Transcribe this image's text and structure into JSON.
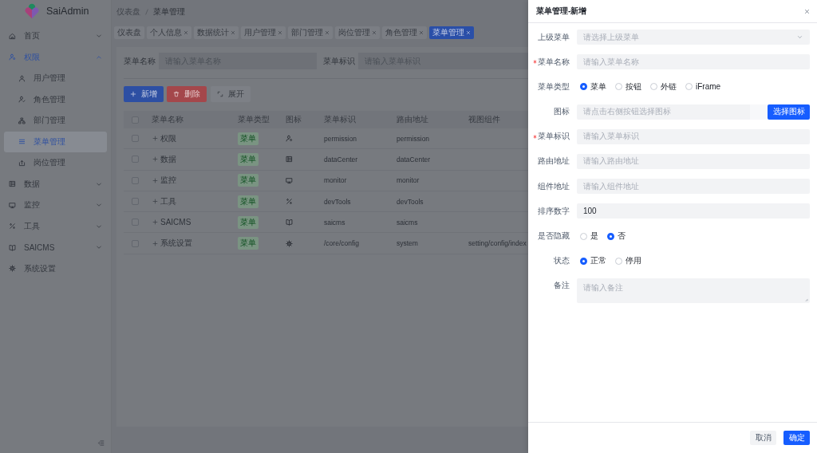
{
  "sidebar": {
    "logo": "SaiAdmin",
    "items": [
      {
        "label": "首页",
        "expanded": false,
        "selected": false
      },
      {
        "label": "权限",
        "expanded": true,
        "selected": false,
        "children": [
          {
            "label": "用户管理",
            "selected": false
          },
          {
            "label": "角色管理",
            "selected": false
          },
          {
            "label": "部门管理",
            "selected": false
          },
          {
            "label": "菜单管理",
            "selected": true
          },
          {
            "label": "岗位管理",
            "selected": false
          }
        ]
      },
      {
        "label": "数据",
        "expanded": false,
        "selected": false
      },
      {
        "label": "监控",
        "expanded": false,
        "selected": false
      },
      {
        "label": "工具",
        "expanded": false,
        "selected": false
      },
      {
        "label": "SAICMS",
        "expanded": false,
        "selected": false
      },
      {
        "label": "系统设置",
        "selected": false
      }
    ]
  },
  "breadcrumb": [
    "仪表盘",
    "菜单管理"
  ],
  "tabs": [
    {
      "label": "仪表盘",
      "closable": false,
      "selected": false
    },
    {
      "label": "个人信息",
      "closable": true,
      "selected": false
    },
    {
      "label": "数据统计",
      "closable": true,
      "selected": false
    },
    {
      "label": "用户管理",
      "closable": true,
      "selected": false
    },
    {
      "label": "部门管理",
      "closable": true,
      "selected": false
    },
    {
      "label": "岗位管理",
      "closable": true,
      "selected": false
    },
    {
      "label": "角色管理",
      "closable": true,
      "selected": false
    },
    {
      "label": "菜单管理",
      "closable": true,
      "selected": true
    }
  ],
  "search": {
    "fields": [
      {
        "label": "菜单名称",
        "placeholder": "请输入菜单名称"
      },
      {
        "label": "菜单标识",
        "placeholder": "请输入菜单标识"
      }
    ]
  },
  "actions": [
    {
      "label": "新增",
      "kind": "primary"
    },
    {
      "label": "删除",
      "kind": "danger"
    },
    {
      "label": "展开",
      "kind": "default"
    }
  ],
  "table": {
    "select_all": {
      "checked": false
    },
    "columns": [
      "菜单名称",
      "菜单类型",
      "图标",
      "菜单标识",
      "路由地址",
      "视图组件"
    ],
    "rows": [
      {
        "name": "权限",
        "type": "菜单",
        "key": "permission",
        "route": "permission",
        "checked": false,
        "expanded": false
      },
      {
        "name": "数据",
        "type": "菜单",
        "key": "dataCenter",
        "route": "dataCenter",
        "checked": false,
        "expanded": false
      },
      {
        "name": "监控",
        "type": "菜单",
        "key": "monitor",
        "route": "monitor",
        "checked": false,
        "expanded": false
      },
      {
        "name": "工具",
        "type": "菜单",
        "key": "devTools",
        "route": "devTools",
        "checked": false,
        "expanded": false
      },
      {
        "name": "SAICMS",
        "type": "菜单",
        "key": "saicms",
        "route": "saicms",
        "checked": false,
        "expanded": false
      },
      {
        "name": "系统设置",
        "type": "菜单",
        "key": "/core/config",
        "route": "system",
        "component": "setting/config/index",
        "checked": false,
        "expanded": false
      }
    ]
  },
  "drawer": {
    "title": "菜单管理-新增",
    "fields": [
      {
        "kind": "select",
        "label": "上级菜单",
        "required": false,
        "placeholder": "请选择上级菜单"
      },
      {
        "kind": "input",
        "label": "菜单名称",
        "required": true,
        "placeholder": "请输入菜单名称"
      },
      {
        "kind": "radio",
        "label": "菜单类型",
        "required": false,
        "options": [
          {
            "label": "菜单",
            "selected": true
          },
          {
            "label": "按钮",
            "selected": false
          },
          {
            "label": "外链",
            "selected": false
          },
          {
            "label": "iFrame",
            "selected": false
          }
        ]
      },
      {
        "kind": "icon_picker",
        "label": "图标",
        "required": false,
        "placeholder": "请点击右侧按钮选择图标",
        "button": "选择图标"
      },
      {
        "kind": "input",
        "label": "菜单标识",
        "required": true,
        "placeholder": "请输入菜单标识"
      },
      {
        "kind": "input",
        "label": "路由地址",
        "required": false,
        "placeholder": "请输入路由地址"
      },
      {
        "kind": "input",
        "label": "组件地址",
        "required": false,
        "placeholder": "请输入组件地址"
      },
      {
        "kind": "input",
        "label": "排序数字",
        "required": false,
        "value": "100"
      },
      {
        "kind": "radio",
        "label": "是否隐藏",
        "required": false,
        "options": [
          {
            "label": "是",
            "selected": false
          },
          {
            "label": "否",
            "selected": true
          }
        ]
      },
      {
        "kind": "radio",
        "label": "状态",
        "required": false,
        "options": [
          {
            "label": "正常",
            "selected": true
          },
          {
            "label": "停用",
            "selected": false
          }
        ]
      },
      {
        "kind": "textarea",
        "label": "备注",
        "required": false,
        "placeholder": "请输入备注"
      }
    ],
    "buttons": [
      {
        "label": "取消",
        "kind": "default"
      },
      {
        "label": "确定",
        "kind": "primary"
      }
    ]
  }
}
